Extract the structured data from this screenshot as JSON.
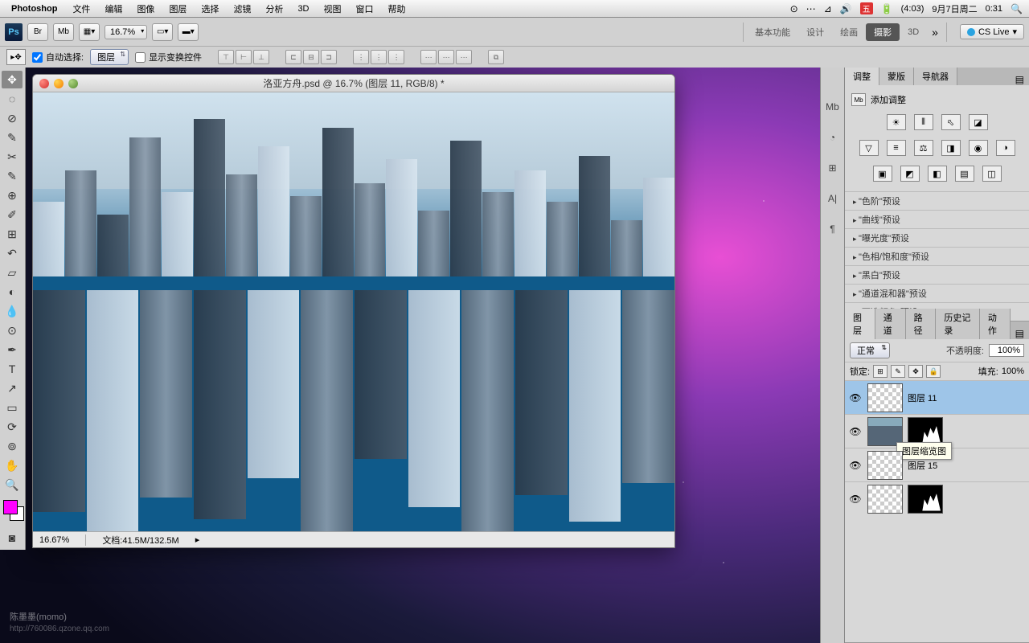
{
  "menubar": {
    "app": "Photoshop",
    "items": [
      "文件",
      "编辑",
      "图像",
      "图层",
      "选择",
      "滤镜",
      "分析",
      "3D",
      "视图",
      "窗口",
      "帮助"
    ],
    "battery": "(4:03)",
    "date": "9月7日周二",
    "time": "0:31",
    "input_icon": "五"
  },
  "toolbar": {
    "zoom": "16.7%",
    "zoom2": "16.7%",
    "workspaces": [
      "基本功能",
      "设计",
      "绘画",
      "摄影",
      "3D"
    ],
    "active_workspace": 3,
    "cslive": "CS Live"
  },
  "options": {
    "auto_select": "自动选择:",
    "auto_select_val": "图层",
    "show_transform": "显示变换控件"
  },
  "doc": {
    "title": "洛亚方舟.psd @ 16.7% (图层 11, RGB/8) *",
    "zoom_status": "16.67%",
    "size_status": "文档:41.5M/132.5M"
  },
  "adjustments": {
    "tabs": [
      "调整",
      "蒙版",
      "导航器"
    ],
    "label": "添加调整",
    "presets": [
      "\"色阶\"预设",
      "\"曲线\"预设",
      "\"曝光度\"预设",
      "\"色相/饱和度\"预设",
      "\"黑白\"预设",
      "\"通道混和器\"预设",
      "\"可选颜色\"预设"
    ]
  },
  "layers": {
    "tabs": [
      "图层",
      "通道",
      "路径",
      "历史记录",
      "动作"
    ],
    "blend": "正常",
    "opacity_label": "不透明度:",
    "opacity": "100%",
    "lock_label": "锁定:",
    "fill_label": "填充:",
    "fill": "100%",
    "items": [
      {
        "name": "图层 11",
        "active": true,
        "mask": false
      },
      {
        "name": "",
        "active": false,
        "mask": true,
        "city": true
      },
      {
        "name": "图层 15",
        "active": false,
        "mask": false
      },
      {
        "name": "",
        "active": false,
        "mask": true,
        "city": false
      }
    ],
    "tooltip": "图层缩览图"
  },
  "watermark": {
    "name": "陈墨墨(momo)",
    "url": "http://760086.qzone.qq.com"
  }
}
